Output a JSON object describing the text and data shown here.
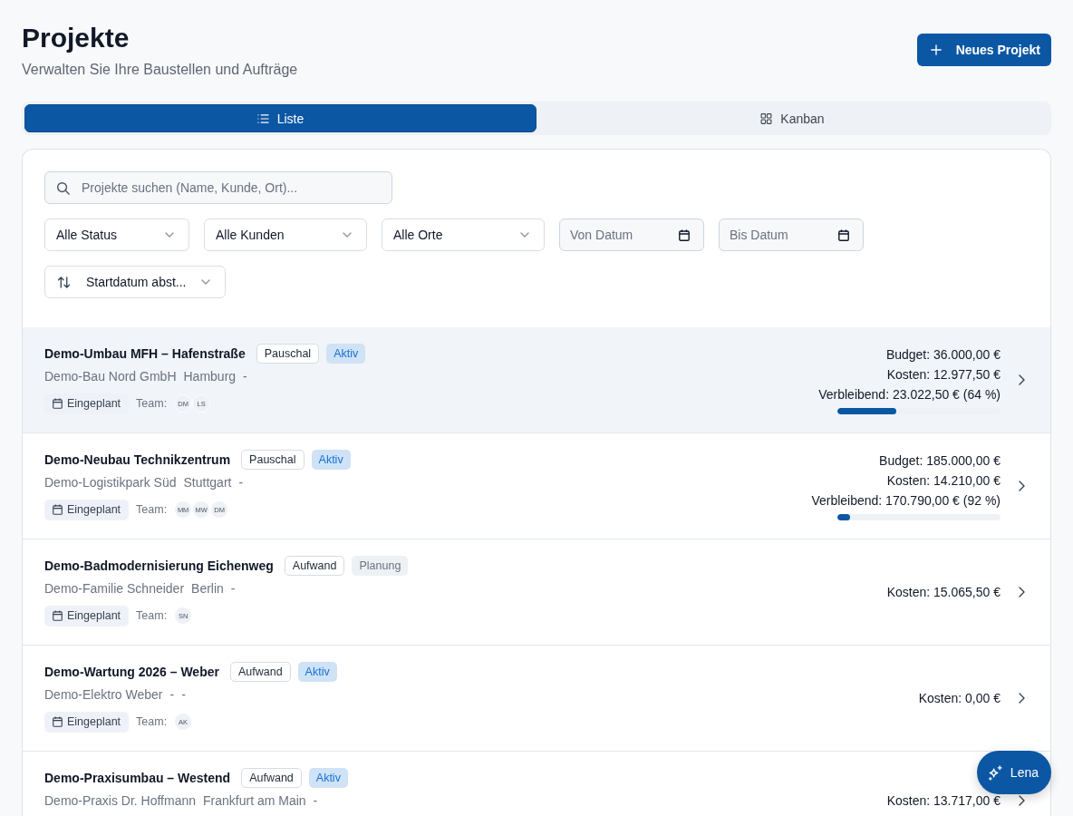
{
  "header": {
    "title": "Projekte",
    "subtitle": "Verwalten Sie Ihre Baustellen und Aufträge",
    "button": "Neues Projekt"
  },
  "view_tabs": [
    {
      "label": "Liste",
      "kind": "list",
      "selected": true
    },
    {
      "label": "Kanban",
      "kind": "board",
      "selected": false
    }
  ],
  "search": {
    "placeholder": "Projekte suchen (Name, Kunde, Ort)..."
  },
  "filters": [
    {
      "kind": "select",
      "value": "Alle Status"
    },
    {
      "kind": "select",
      "value": "Alle Kunden"
    },
    {
      "kind": "select",
      "value": "Alle Orte"
    },
    {
      "kind": "date",
      "placeholder": "Von Datum"
    },
    {
      "kind": "date",
      "placeholder": "Bis Datum"
    }
  ],
  "sort": {
    "value": "Startdatum abst..."
  },
  "projects": [
    {
      "title": "Demo-Umbau MFH – Hafenstraße",
      "badges": [
        {
          "label": "Pauschal",
          "kind": "billing"
        },
        {
          "label": "Aktiv",
          "kind": "active"
        }
      ],
      "details": [
        "Demo-Bau Nord GmbH",
        "Hamburg",
        "-"
      ],
      "schedule": "Eingeplant",
      "team_label": "Team:",
      "team": [
        "DM",
        "LS"
      ],
      "figures": [
        "Budget: 36.000,00 €",
        "Kosten: 12.977,50 €",
        "Verbleibend: 23.022,50 € (64 %)"
      ],
      "level": 0.36,
      "highlighted": true
    },
    {
      "title": "Demo-Neubau Technikzentrum",
      "badges": [
        {
          "label": "Pauschal",
          "kind": "billing"
        },
        {
          "label": "Aktiv",
          "kind": "active"
        }
      ],
      "details": [
        "Demo-Logistikpark Süd",
        "Stuttgart",
        "-"
      ],
      "schedule": "Eingeplant",
      "team_label": "Team:",
      "team": [
        "MM",
        "MW",
        "DM"
      ],
      "figures": [
        "Budget: 185.000,00 €",
        "Kosten: 14.210,00 €",
        "Verbleibend: 170.790,00 € (92 %)"
      ],
      "level": 0.077,
      "highlighted": false
    },
    {
      "title": "Demo-Badmodernisierung Eichenweg",
      "badges": [
        {
          "label": "Aufwand",
          "kind": "billing"
        },
        {
          "label": "Planung",
          "kind": "planning"
        }
      ],
      "details": [
        "Demo-Familie Schneider",
        "Berlin",
        "-"
      ],
      "schedule": "Eingeplant",
      "team_label": "Team:",
      "team": [
        "SN"
      ],
      "figures": [
        "Kosten: 15.065,50 €"
      ],
      "highlighted": false
    },
    {
      "title": "Demo-Wartung 2026 – Weber",
      "badges": [
        {
          "label": "Aufwand",
          "kind": "billing"
        },
        {
          "label": "Aktiv",
          "kind": "active"
        }
      ],
      "details": [
        "Demo-Elektro Weber",
        "-",
        "-"
      ],
      "schedule": "Eingeplant",
      "team_label": "Team:",
      "team": [
        "AK"
      ],
      "figures": [
        "Kosten: 0,00 €"
      ],
      "highlighted": false
    },
    {
      "title": "Demo-Praxisumbau – Westend",
      "badges": [
        {
          "label": "Aufwand",
          "kind": "billing"
        },
        {
          "label": "Aktiv",
          "kind": "active"
        }
      ],
      "details": [
        "Demo-Praxis Dr. Hoffmann",
        "Frankfurt am Main",
        "-"
      ],
      "figures": [
        "Kosten: 13.717,00 €"
      ],
      "highlighted": false
    }
  ],
  "assistant_button": {
    "label": "Lena"
  }
}
